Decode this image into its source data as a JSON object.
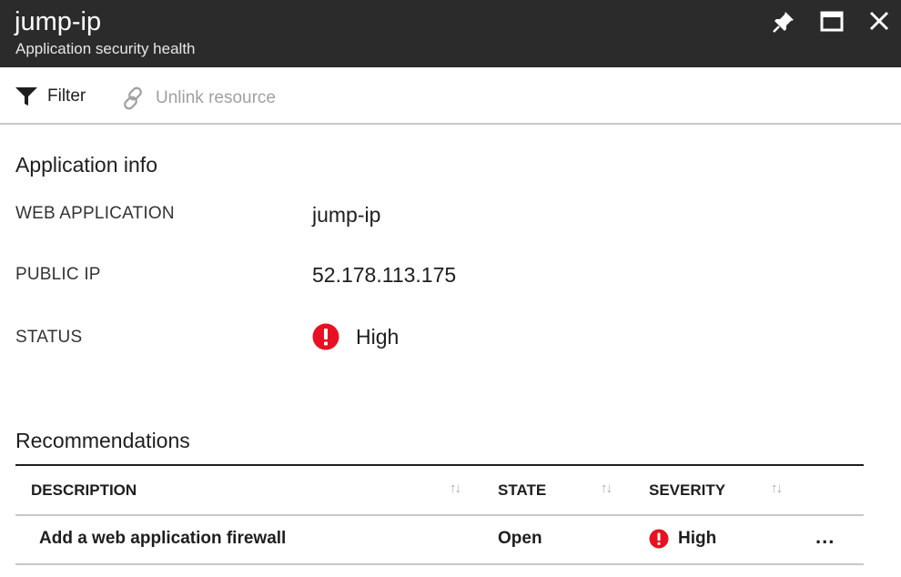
{
  "header": {
    "title": "jump-ip",
    "subtitle": "Application security health"
  },
  "toolbar": {
    "filter_label": "Filter",
    "unlink_label": "Unlink resource"
  },
  "app_info": {
    "section_title": "Application info",
    "fields": [
      {
        "label": "WEB APPLICATION",
        "value": "jump-ip"
      },
      {
        "label": "PUBLIC IP",
        "value": "52.178.113.175"
      },
      {
        "label": "STATUS",
        "value": "High"
      }
    ]
  },
  "recommendations": {
    "section_title": "Recommendations",
    "columns": [
      "DESCRIPTION",
      "STATE",
      "SEVERITY"
    ],
    "sort_glyph": "↑↓",
    "rows": [
      {
        "description": "Add a web application firewall",
        "state": "Open",
        "severity": "High",
        "more": "..."
      }
    ]
  },
  "colors": {
    "header_bg": "#2b2b2b",
    "severity_high": "#e81123"
  },
  "icons": {
    "pin": "pin-icon",
    "maximize": "maximize-icon",
    "close": "close-icon",
    "filter": "filter-icon",
    "link": "link-icon",
    "alert": "alert-icon"
  }
}
